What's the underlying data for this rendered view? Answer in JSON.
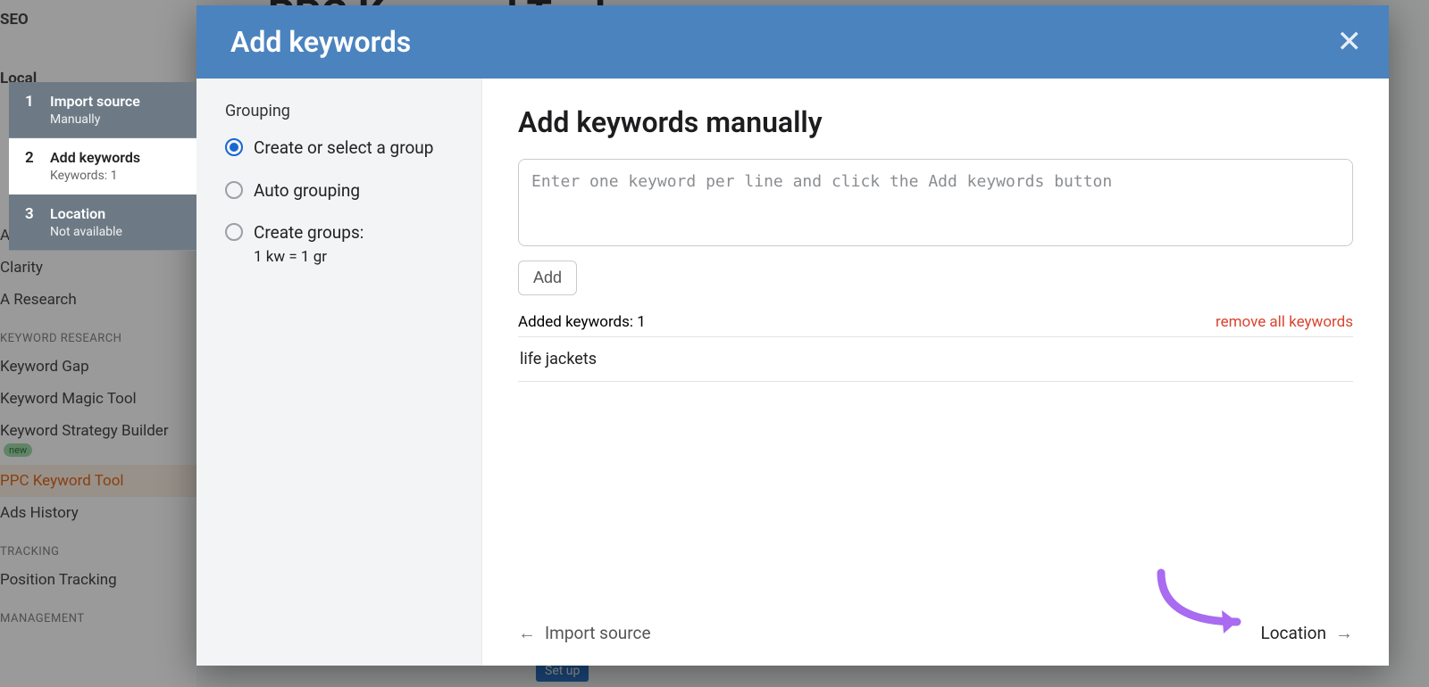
{
  "bg": {
    "sidebar": {
      "seo": "SEO",
      "local": "Local",
      "items_top": [
        "",
        "Advertising Research",
        "Clarity",
        "A Research"
      ],
      "heading_kw": "KEYWORD RESEARCH",
      "items_kw": [
        "Keyword Gap",
        "Keyword Magic Tool",
        "Keyword Strategy Builder",
        "PPC Keyword Tool",
        "Ads History"
      ],
      "new_badge": "new",
      "heading_track": "TRACKING",
      "items_track": [
        "Position Tracking"
      ],
      "heading_mgmt": "MANAGEMENT"
    },
    "title": "PPC Keyword Tool",
    "setup": "Set up"
  },
  "modal_header": {
    "title": "Add keywords",
    "close": "✕"
  },
  "steps": [
    {
      "num": "1",
      "label": "Import source",
      "sub": "Manually"
    },
    {
      "num": "2",
      "label": "Add keywords",
      "sub": "Keywords: 1"
    },
    {
      "num": "3",
      "label": "Location",
      "sub": "Not available"
    }
  ],
  "grouping": {
    "heading": "Grouping",
    "opt1": "Create or select a group",
    "opt2": "Auto grouping",
    "opt3": "Create groups:",
    "opt3_sub": "1 kw = 1 gr"
  },
  "main": {
    "title": "Add keywords manually",
    "placeholder": "Enter one keyword per line and click the Add keywords button",
    "add_btn": "Add",
    "added_count": "Added keywords: 1",
    "remove_all": "remove all keywords",
    "keywords": [
      "life jackets"
    ]
  },
  "footer": {
    "back_arrow": "←",
    "back": "Import source",
    "next": "Location",
    "next_arrow": "→"
  }
}
